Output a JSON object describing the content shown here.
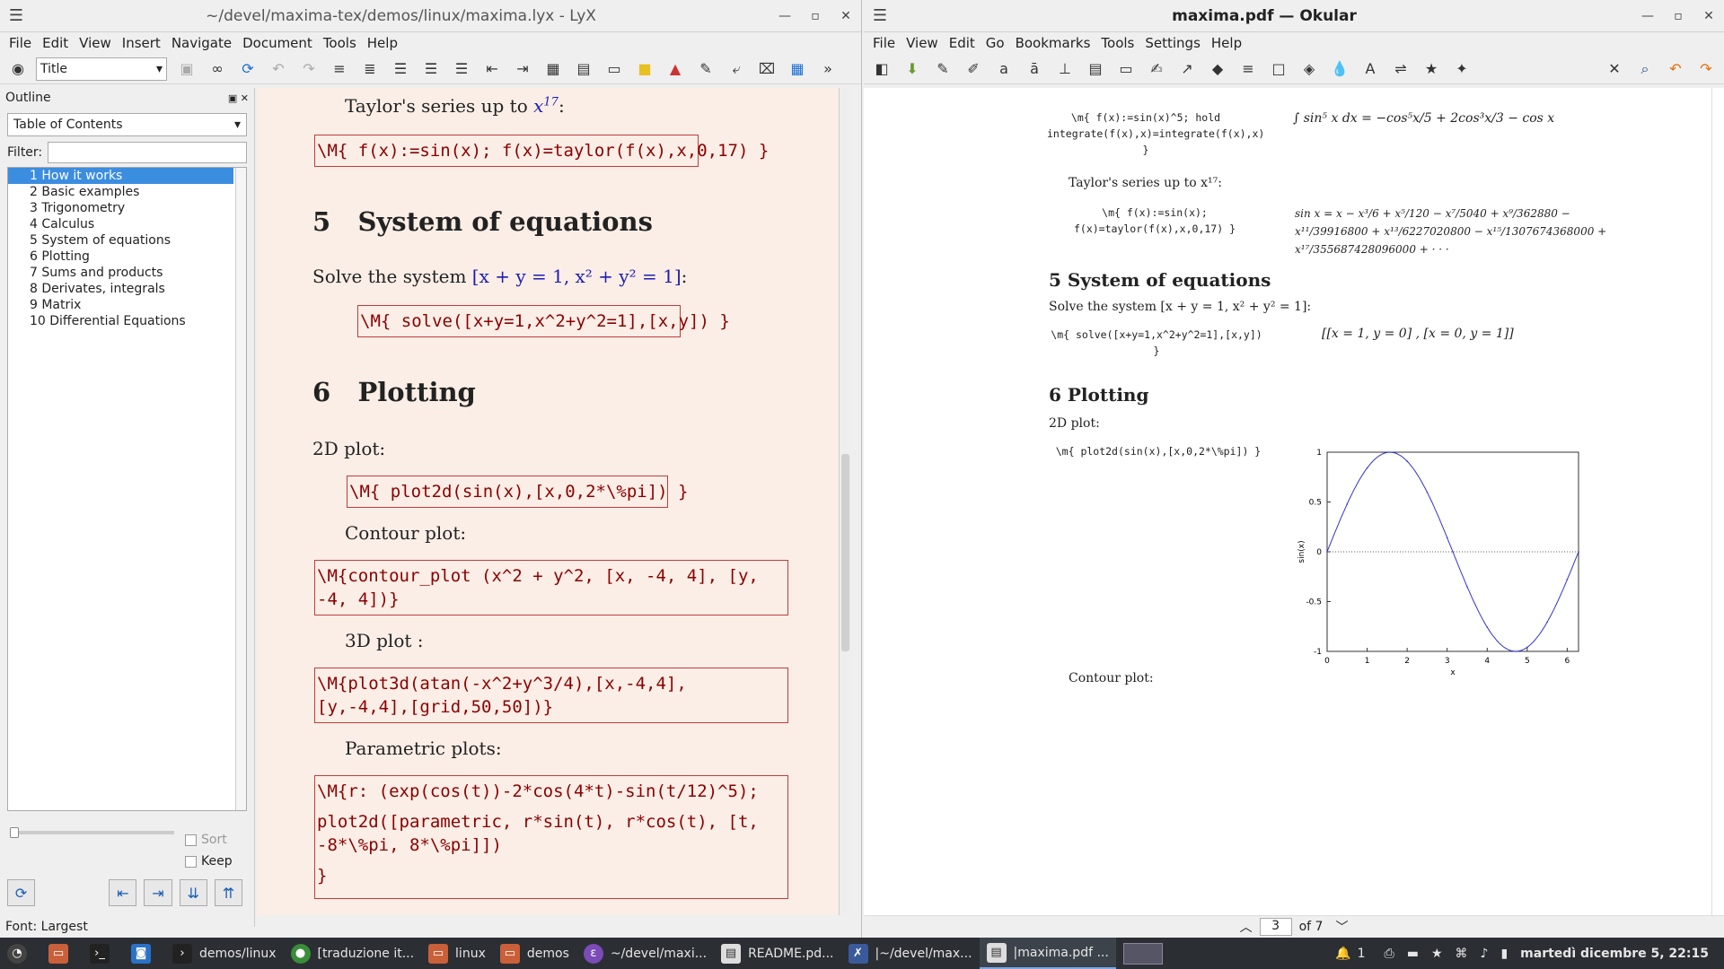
{
  "lyx": {
    "title": "~/devel/maxima-tex/demos/linux/maxima.lyx - LyX",
    "menu": [
      "File",
      "Edit",
      "View",
      "Insert",
      "Navigate",
      "Document",
      "Tools",
      "Help"
    ],
    "layout_value": "Title",
    "outline": {
      "label": "Outline",
      "type": "Table of Contents",
      "filter_label": "Filter:",
      "items": [
        "1 How it works",
        "2 Basic examples",
        "3 Trigonometry",
        "4 Calculus",
        "5 System of equations",
        "6 Plotting",
        "7 Sums and products",
        "8 Derivates, integrals",
        "9 Matrix",
        "10 Differential Equations"
      ],
      "sort_label": "Sort",
      "keep_label": "Keep"
    },
    "status": "Font: Largest",
    "doc": {
      "taylor_text": "Taylor's series up to",
      "taylor_exp_base": "x",
      "taylor_exp": "17",
      "taylor_colon": ":",
      "taylor_code": "\\M{ f(x):=sin(x); f(x)=taylor(f(x),x,0,17) }",
      "sec5_num": "5",
      "sec5_title": "System of equations",
      "solve_text": "Solve the system",
      "solve_math": "[x + y = 1, x² + y² = 1]",
      "solve_colon": ":",
      "solve_code": "\\M{ solve([x+y=1,x^2+y^2=1],[x,y]) }",
      "sec6_num": "6",
      "sec6_title": "Plotting",
      "plot2d_text": "2D plot:",
      "plot2d_code": "\\M{ plot2d(sin(x),[x,0,2*\\%pi]) }",
      "contour_text": "Contour plot:",
      "contour_code": "\\M{contour_plot (x^2 + y^2, [x, -4, 4], [y,\n-4, 4])}",
      "plot3d_text": "3D plot :",
      "plot3d_code": "\\M{plot3d(atan(-x^2+y^3/4),[x,-4,4],\n[y,-4,4],[grid,50,50])}",
      "param_text": "Parametric plots:",
      "param_code1": "\\M{r: (exp(cos(t))-2*cos(4*t)-sin(t/12)^5);",
      "param_code2": "plot2d([parametric, r*sin(t), r*cos(t), [t,\n-8*\\%pi, 8*\\%pi]])",
      "param_code3": "}"
    }
  },
  "okular": {
    "title": "maxima.pdf — Okular",
    "menu": [
      "File",
      "View",
      "Edit",
      "Go",
      "Bookmarks",
      "Tools",
      "Settings",
      "Help"
    ],
    "pdf": {
      "integ_code": "\\m{ f(x):=sin(x)^5; hold\nintegrate(f(x),x)=integrate(f(x),x)\n}",
      "integ_result": "∫ sin⁵ x dx = −cos⁵x/5 + 2cos³x/3 − cos x",
      "taylor_text": "Taylor's series up to x¹⁷:",
      "taylor_code": "\\m{ f(x):=sin(x);\nf(x)=taylor(f(x),x,0,17) }",
      "taylor_result_1": "sin x = x − x³/6 + x⁵/120 − x⁷/5040 + x⁹/362880 −",
      "taylor_result_2": "x¹¹/39916800 + x¹³/6227020800 − x¹⁵/1307674368000 +",
      "taylor_result_3": "x¹⁷/355687428096000 + · · ·",
      "sec5": "5    System of equations",
      "solve_text": "Solve the system [x + y = 1, x² + y² = 1]:",
      "solve_code": "\\m{ solve([x+y=1,x^2+y^2=1],[x,y])\n}",
      "solve_result": "[[x = 1, y = 0] , [x = 0, y = 1]]",
      "sec6": "6    Plotting",
      "plot2d_text": "2D plot:",
      "plot2d_code": "\\m{ plot2d(sin(x),[x,0,2*\\%pi]) }",
      "contour_text": "Contour plot:"
    },
    "page_current": "3",
    "page_of": "of",
    "page_total": "7"
  },
  "chart_data": {
    "type": "line",
    "title": "",
    "xlabel": "x",
    "ylabel": "sin(x)",
    "xlim": [
      0,
      6.283
    ],
    "ylim": [
      -1,
      1
    ],
    "xticks": [
      "0",
      "1",
      "2",
      "3",
      "4",
      "5",
      "6"
    ],
    "yticks": [
      "1",
      "0.5",
      "0",
      "-0.5",
      "-1"
    ],
    "series": [
      {
        "x": [
          0,
          0.5,
          1,
          1.5708,
          2,
          2.5,
          3,
          3.1416,
          3.5,
          4,
          4.7124,
          5,
          5.5,
          6,
          6.2832
        ],
        "values": [
          0,
          0.479,
          0.841,
          1,
          0.909,
          0.598,
          0.141,
          0,
          -0.351,
          -0.757,
          -1,
          -0.959,
          -0.706,
          -0.279,
          0
        ]
      }
    ],
    "color": "#3333cc",
    "grid": false
  },
  "taskbar": {
    "tasks": [
      "demos/linux",
      "[traduzione it...",
      "linux",
      "demos",
      "~/devel/maxi...",
      "README.pd...",
      "|~/devel/max...",
      "|maxima.pdf ..."
    ],
    "clock": "martedì dicembre   5, 22:15",
    "notif": "1"
  }
}
